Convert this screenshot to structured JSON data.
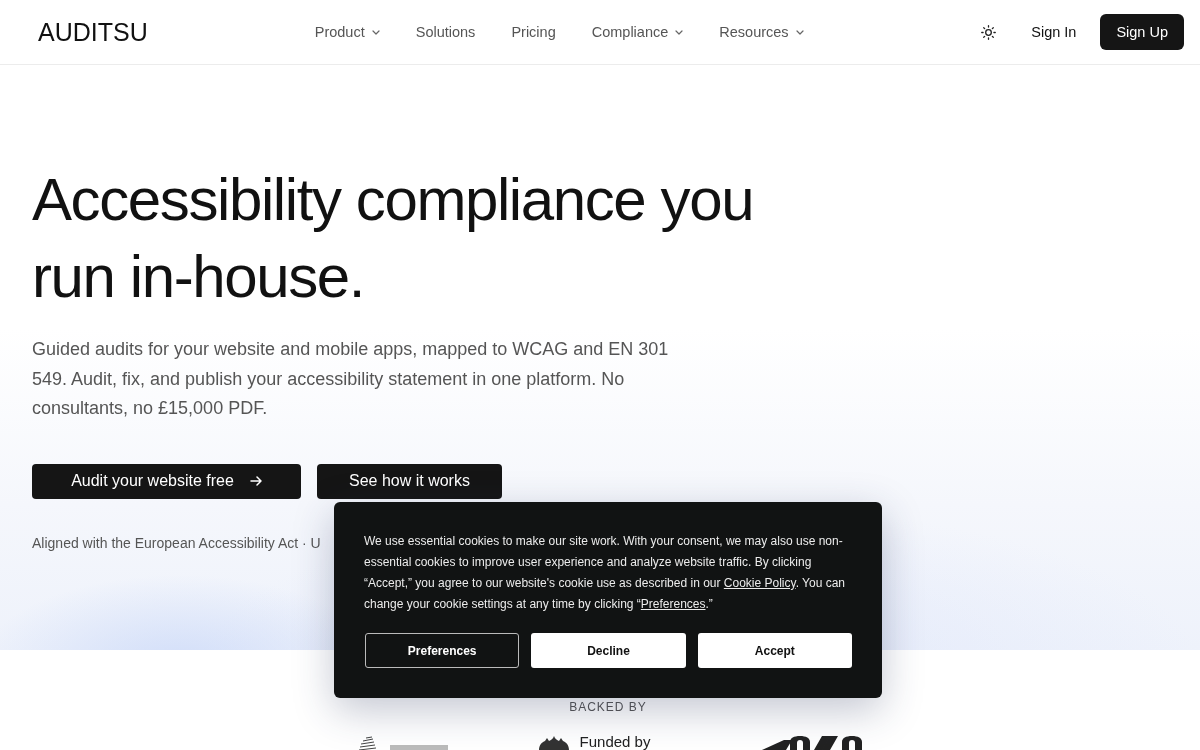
{
  "header": {
    "logo": "AUDITSU",
    "nav": [
      {
        "label": "Product",
        "has_menu": true
      },
      {
        "label": "Solutions",
        "has_menu": false
      },
      {
        "label": "Pricing",
        "has_menu": false
      },
      {
        "label": "Compliance",
        "has_menu": true
      },
      {
        "label": "Resources",
        "has_menu": true
      }
    ],
    "sign_in": "Sign In",
    "sign_up": "Sign Up"
  },
  "hero": {
    "title": "Accessibility compliance you run in-house.",
    "subtitle": "Guided audits for your website and mobile apps, mapped to WCAG and EN 301 549. Audit, fix, and publish your accessibility statement in one platform. No consultants, no £15,000 PDF.",
    "buttons": [
      {
        "label": "Audit your website free",
        "trailing_arrow": true
      },
      {
        "label": "See how it works",
        "trailing_arrow": false
      }
    ],
    "tagline": "Aligned with the European Accessibility Act · U"
  },
  "cookie_banner": {
    "message": [
      {
        "kind": "text",
        "text": "We use essential cookies to make our site work. With your consent, we may also use non-essential cookies to improve user experience and analyze website traffic. By clicking “Accept,” you agree to our website's cookie use as described in our "
      },
      {
        "kind": "link",
        "text": "Cookie Policy"
      },
      {
        "kind": "text",
        "text": ". You can change your cookie settings at any time by clicking “"
      },
      {
        "kind": "link",
        "text": "Preferences"
      },
      {
        "kind": "text",
        "text": ".”"
      }
    ],
    "buttons": [
      {
        "label": "Preferences",
        "kind": "outline"
      },
      {
        "label": "Decline",
        "kind": "solid"
      },
      {
        "label": "Accept",
        "kind": "solid"
      }
    ]
  },
  "backers": {
    "heading": "BACKED BY",
    "logos": [
      {
        "kind": "stripes"
      },
      {
        "kind": "crest",
        "caption": "Funded by"
      },
      {
        "kind": "wordmark"
      }
    ]
  }
}
